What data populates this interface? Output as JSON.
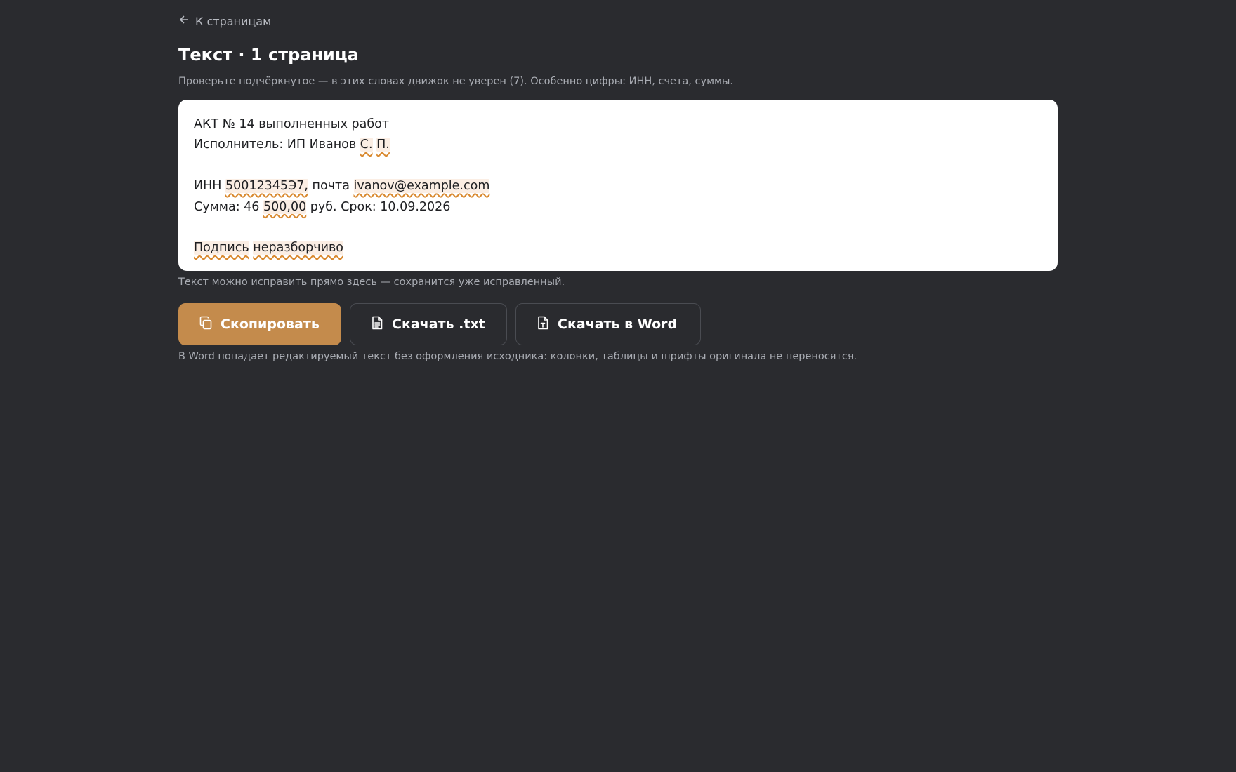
{
  "nav": {
    "back_label": "К страницам"
  },
  "header": {
    "title": "Текст · 1 страница",
    "hint": "Проверьте подчёркнутое — в этих словах движок не уверен (7). Особенно цифры: ИНН, счета, суммы."
  },
  "document": {
    "line1": "АКТ № 14 выполненных работ",
    "line2_prefix": "Исполнитель: ИП Иванов ",
    "line2_u1": "С.",
    "line2_u2": "П.",
    "line4_prefix": "ИНН ",
    "line4_u1": "50012345Э7,",
    "line4_mid": " почта ",
    "line4_u2": "ivanov@example.com",
    "line5_prefix": "Сумма: 46 ",
    "line5_u1": "500,00",
    "line5_suffix": " руб. Срок: 10.09.2026",
    "line7_u1": "Подпись",
    "line7_u2": "неразборчиво"
  },
  "edit_note": "Текст можно исправить прямо здесь — сохранится уже исправленный.",
  "actions": {
    "copy_label": "Скопировать",
    "download_txt_label": "Скачать .txt",
    "download_word_label": "Скачать в Word"
  },
  "footnote": "В Word попадает редактируемый текст без оформления исходника: колонки, таблицы и шрифты оригинала не переносятся.",
  "colors": {
    "background": "#2a2b2f",
    "accent": "#c48b4c",
    "underline": "#d9892f",
    "highlight": "#fbeee4"
  },
  "icons": {
    "back": "arrow-left-icon",
    "copy": "copy-icon",
    "txt": "file-text-icon",
    "word": "file-word-icon"
  }
}
